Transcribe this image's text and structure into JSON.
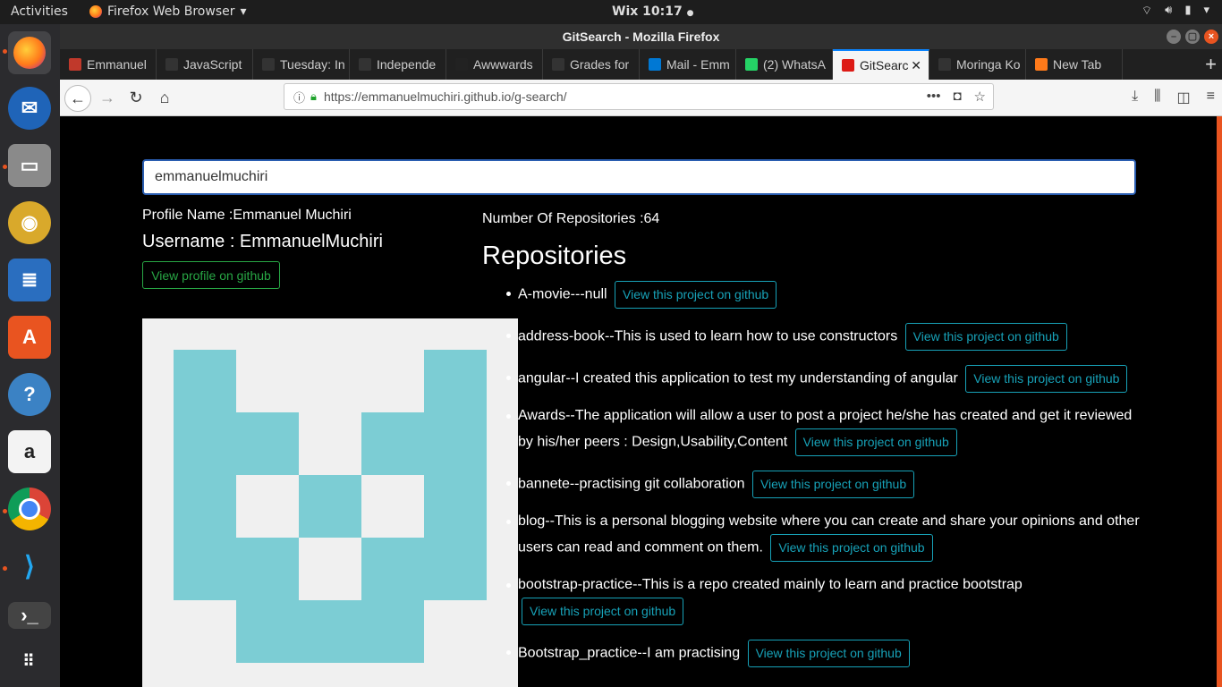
{
  "topbar": {
    "activities": "Activities",
    "app_menu": "Firefox Web Browser",
    "clock": "Wix 10:17"
  },
  "dock": {
    "items": [
      "firefox-icon",
      "thunderbird-icon",
      "files-icon",
      "rhythmbox-icon",
      "libreoffice-writer-icon",
      "software-center-icon",
      "help-icon",
      "amazon-icon",
      "chrome-icon",
      "vscode-icon",
      "terminal-icon",
      "app-grid-icon"
    ]
  },
  "window": {
    "title": "GitSearch - Mozilla Firefox"
  },
  "tabs": [
    {
      "label": "Emmanuel",
      "color": "#c0392b"
    },
    {
      "label": "JavaScript",
      "color": "#333333"
    },
    {
      "label": "Tuesday: In",
      "color": "#333333"
    },
    {
      "label": "Independe",
      "color": "#333333"
    },
    {
      "label": "Awwwards",
      "color": "#222222"
    },
    {
      "label": "Grades for",
      "color": "#333333"
    },
    {
      "label": "Mail - Emm",
      "color": "#0078d4"
    },
    {
      "label": "(2) WhatsA",
      "color": "#25d366"
    },
    {
      "label": "GitSearc",
      "color": "#dd1b16",
      "active": true
    },
    {
      "label": "Moringa Ko",
      "color": "#333333"
    },
    {
      "label": "New Tab",
      "color": "#ff7a1a"
    }
  ],
  "navbar": {
    "url": "https://emmanuelmuchiri.github.io/g-search/"
  },
  "page": {
    "search_value": "emmanuelmuchiri",
    "profile_name": "Profile Name :Emmanuel Muchiri",
    "username": "Username : EmmanuelMuchiri",
    "view_profile": "View profile on github",
    "repo_count": "Number Of Repositories :64",
    "repo_heading": "Repositories",
    "repo_button": "View this project on github",
    "repos": [
      "A-movie---null",
      "address-book--This is used to learn how to use constructors",
      "angular--I created this application to test my understanding of angular",
      "Awards--The application will allow a user to post a project he/she has created and get it reviewed by his/her peers : Design,Usability,Content",
      "bannete--practising git collaboration",
      "blog--This is a personal blogging website where you can create and share your opinions and other users can read and comment on them.",
      "bootstrap-practice--This is a repo created mainly to learn and practice bootstrap",
      "Bootstrap_practice--I am practising"
    ],
    "avatar_color": "#7ccdd4"
  }
}
